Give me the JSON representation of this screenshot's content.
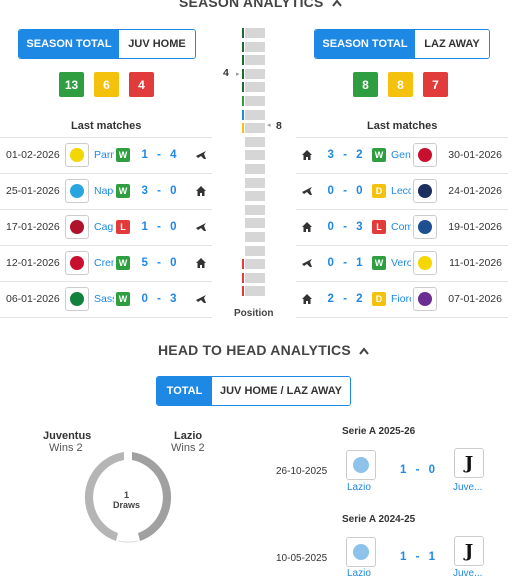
{
  "season": {
    "title": "SEASON ANALYTICS",
    "left_tabs": [
      "SEASON TOTAL",
      "JUV HOME"
    ],
    "right_tabs": [
      "SEASON TOTAL",
      "LAZ AWAY"
    ],
    "left_form": {
      "wins": "13",
      "draws": "6",
      "losses": "4"
    },
    "right_form": {
      "wins": "8",
      "draws": "8",
      "losses": "7"
    },
    "last_matches_label": "Last matches",
    "position_label": "Position",
    "left_position": "4",
    "right_position": "8",
    "left_matches": [
      {
        "date": "01-02-2026",
        "team": "Parma",
        "result": "W",
        "score": "1 - 4",
        "venue": "away",
        "color": "#f2d600"
      },
      {
        "date": "25-01-2026",
        "team": "Napoli",
        "result": "W",
        "score": "3 - 0",
        "venue": "home",
        "color": "#29a6e0"
      },
      {
        "date": "17-01-2026",
        "team": "Cagliari",
        "result": "L",
        "score": "1 - 0",
        "venue": "away",
        "color": "#b0122b"
      },
      {
        "date": "12-01-2026",
        "team": "Cremonese",
        "result": "W",
        "score": "5 - 0",
        "venue": "home",
        "color": "#c8102e"
      },
      {
        "date": "06-01-2026",
        "team": "Sassuolo",
        "result": "W",
        "score": "0 - 3",
        "venue": "away",
        "color": "#11823b"
      }
    ],
    "right_matches": [
      {
        "date": "30-01-2026",
        "team": "Genoa",
        "result": "W",
        "score": "3 - 2",
        "venue": "home",
        "color": "#c8102e"
      },
      {
        "date": "24-01-2026",
        "team": "Lecce",
        "result": "D",
        "score": "0 - 0",
        "venue": "away",
        "color": "#1c2f5e"
      },
      {
        "date": "19-01-2026",
        "team": "Como",
        "result": "L",
        "score": "0 - 3",
        "venue": "home",
        "color": "#1d4f91"
      },
      {
        "date": "11-01-2026",
        "team": "Verona",
        "result": "W",
        "score": "0 - 1",
        "venue": "away",
        "color": "#f5d600"
      },
      {
        "date": "07-01-2026",
        "team": "Fiorentina",
        "result": "D",
        "score": "2 - 2",
        "venue": "home",
        "color": "#6a2d91"
      }
    ]
  },
  "h2h": {
    "title": "HEAD TO HEAD ANALYTICS",
    "tabs": [
      "TOTAL",
      "JUV HOME / LAZ AWAY"
    ],
    "home_team": "Juventus",
    "home_wins": "Wins 2",
    "away_team": "Lazio",
    "away_wins": "Wins 2",
    "draws_count": "1",
    "draws_label": "Draws",
    "matches": [
      {
        "competition": "Serie A 2025-26",
        "date": "26-10-2025",
        "home": "Lazio",
        "away": "Juve...",
        "score": "1 - 0"
      },
      {
        "competition": "Serie A 2024-25",
        "date": "10-05-2025",
        "home": "Lazio",
        "away": "Juve...",
        "score": "1 - 1"
      }
    ]
  },
  "colors": {
    "accent": "#1e88e5",
    "win": "#2e9e40",
    "draw": "#f4c20d",
    "loss": "#e23b3b"
  }
}
